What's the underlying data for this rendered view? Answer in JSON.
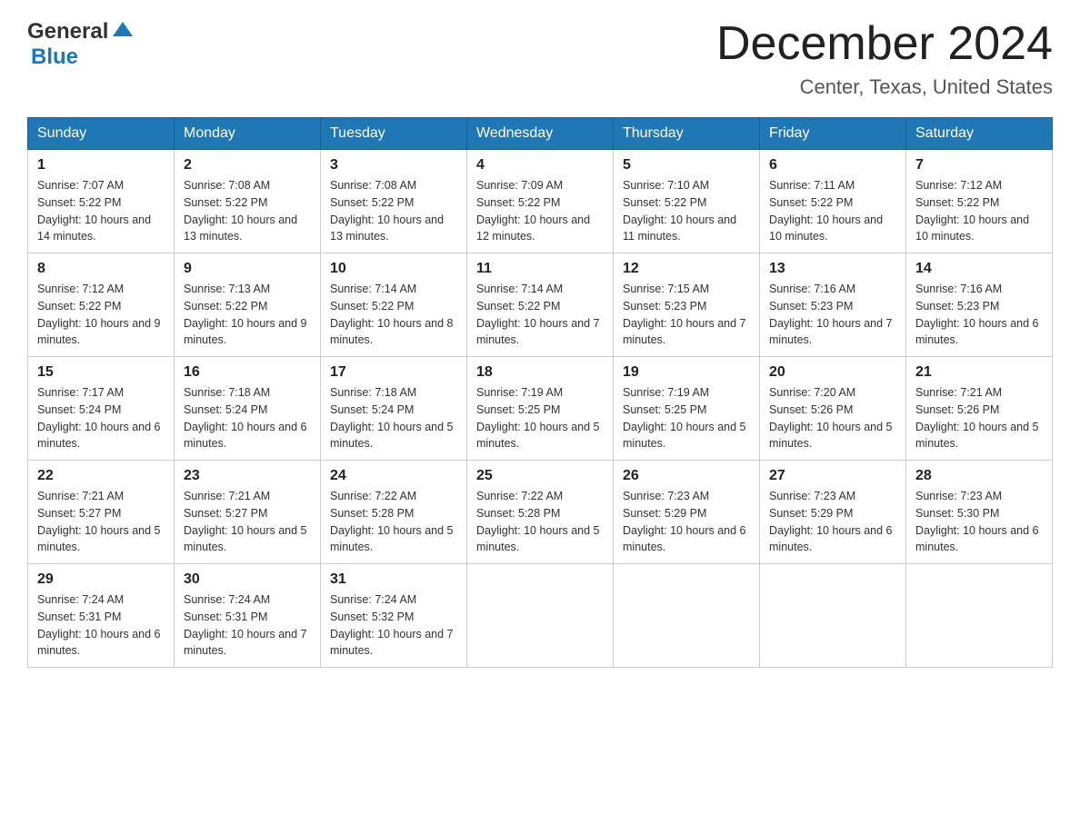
{
  "header": {
    "logo_general": "General",
    "logo_blue": "Blue",
    "month_year": "December 2024",
    "location": "Center, Texas, United States"
  },
  "days_of_week": [
    "Sunday",
    "Monday",
    "Tuesday",
    "Wednesday",
    "Thursday",
    "Friday",
    "Saturday"
  ],
  "weeks": [
    [
      {
        "day": "1",
        "sunrise": "Sunrise: 7:07 AM",
        "sunset": "Sunset: 5:22 PM",
        "daylight": "Daylight: 10 hours and 14 minutes."
      },
      {
        "day": "2",
        "sunrise": "Sunrise: 7:08 AM",
        "sunset": "Sunset: 5:22 PM",
        "daylight": "Daylight: 10 hours and 13 minutes."
      },
      {
        "day": "3",
        "sunrise": "Sunrise: 7:08 AM",
        "sunset": "Sunset: 5:22 PM",
        "daylight": "Daylight: 10 hours and 13 minutes."
      },
      {
        "day": "4",
        "sunrise": "Sunrise: 7:09 AM",
        "sunset": "Sunset: 5:22 PM",
        "daylight": "Daylight: 10 hours and 12 minutes."
      },
      {
        "day": "5",
        "sunrise": "Sunrise: 7:10 AM",
        "sunset": "Sunset: 5:22 PM",
        "daylight": "Daylight: 10 hours and 11 minutes."
      },
      {
        "day": "6",
        "sunrise": "Sunrise: 7:11 AM",
        "sunset": "Sunset: 5:22 PM",
        "daylight": "Daylight: 10 hours and 10 minutes."
      },
      {
        "day": "7",
        "sunrise": "Sunrise: 7:12 AM",
        "sunset": "Sunset: 5:22 PM",
        "daylight": "Daylight: 10 hours and 10 minutes."
      }
    ],
    [
      {
        "day": "8",
        "sunrise": "Sunrise: 7:12 AM",
        "sunset": "Sunset: 5:22 PM",
        "daylight": "Daylight: 10 hours and 9 minutes."
      },
      {
        "day": "9",
        "sunrise": "Sunrise: 7:13 AM",
        "sunset": "Sunset: 5:22 PM",
        "daylight": "Daylight: 10 hours and 9 minutes."
      },
      {
        "day": "10",
        "sunrise": "Sunrise: 7:14 AM",
        "sunset": "Sunset: 5:22 PM",
        "daylight": "Daylight: 10 hours and 8 minutes."
      },
      {
        "day": "11",
        "sunrise": "Sunrise: 7:14 AM",
        "sunset": "Sunset: 5:22 PM",
        "daylight": "Daylight: 10 hours and 7 minutes."
      },
      {
        "day": "12",
        "sunrise": "Sunrise: 7:15 AM",
        "sunset": "Sunset: 5:23 PM",
        "daylight": "Daylight: 10 hours and 7 minutes."
      },
      {
        "day": "13",
        "sunrise": "Sunrise: 7:16 AM",
        "sunset": "Sunset: 5:23 PM",
        "daylight": "Daylight: 10 hours and 7 minutes."
      },
      {
        "day": "14",
        "sunrise": "Sunrise: 7:16 AM",
        "sunset": "Sunset: 5:23 PM",
        "daylight": "Daylight: 10 hours and 6 minutes."
      }
    ],
    [
      {
        "day": "15",
        "sunrise": "Sunrise: 7:17 AM",
        "sunset": "Sunset: 5:24 PM",
        "daylight": "Daylight: 10 hours and 6 minutes."
      },
      {
        "day": "16",
        "sunrise": "Sunrise: 7:18 AM",
        "sunset": "Sunset: 5:24 PM",
        "daylight": "Daylight: 10 hours and 6 minutes."
      },
      {
        "day": "17",
        "sunrise": "Sunrise: 7:18 AM",
        "sunset": "Sunset: 5:24 PM",
        "daylight": "Daylight: 10 hours and 5 minutes."
      },
      {
        "day": "18",
        "sunrise": "Sunrise: 7:19 AM",
        "sunset": "Sunset: 5:25 PM",
        "daylight": "Daylight: 10 hours and 5 minutes."
      },
      {
        "day": "19",
        "sunrise": "Sunrise: 7:19 AM",
        "sunset": "Sunset: 5:25 PM",
        "daylight": "Daylight: 10 hours and 5 minutes."
      },
      {
        "day": "20",
        "sunrise": "Sunrise: 7:20 AM",
        "sunset": "Sunset: 5:26 PM",
        "daylight": "Daylight: 10 hours and 5 minutes."
      },
      {
        "day": "21",
        "sunrise": "Sunrise: 7:21 AM",
        "sunset": "Sunset: 5:26 PM",
        "daylight": "Daylight: 10 hours and 5 minutes."
      }
    ],
    [
      {
        "day": "22",
        "sunrise": "Sunrise: 7:21 AM",
        "sunset": "Sunset: 5:27 PM",
        "daylight": "Daylight: 10 hours and 5 minutes."
      },
      {
        "day": "23",
        "sunrise": "Sunrise: 7:21 AM",
        "sunset": "Sunset: 5:27 PM",
        "daylight": "Daylight: 10 hours and 5 minutes."
      },
      {
        "day": "24",
        "sunrise": "Sunrise: 7:22 AM",
        "sunset": "Sunset: 5:28 PM",
        "daylight": "Daylight: 10 hours and 5 minutes."
      },
      {
        "day": "25",
        "sunrise": "Sunrise: 7:22 AM",
        "sunset": "Sunset: 5:28 PM",
        "daylight": "Daylight: 10 hours and 5 minutes."
      },
      {
        "day": "26",
        "sunrise": "Sunrise: 7:23 AM",
        "sunset": "Sunset: 5:29 PM",
        "daylight": "Daylight: 10 hours and 6 minutes."
      },
      {
        "day": "27",
        "sunrise": "Sunrise: 7:23 AM",
        "sunset": "Sunset: 5:29 PM",
        "daylight": "Daylight: 10 hours and 6 minutes."
      },
      {
        "day": "28",
        "sunrise": "Sunrise: 7:23 AM",
        "sunset": "Sunset: 5:30 PM",
        "daylight": "Daylight: 10 hours and 6 minutes."
      }
    ],
    [
      {
        "day": "29",
        "sunrise": "Sunrise: 7:24 AM",
        "sunset": "Sunset: 5:31 PM",
        "daylight": "Daylight: 10 hours and 6 minutes."
      },
      {
        "day": "30",
        "sunrise": "Sunrise: 7:24 AM",
        "sunset": "Sunset: 5:31 PM",
        "daylight": "Daylight: 10 hours and 7 minutes."
      },
      {
        "day": "31",
        "sunrise": "Sunrise: 7:24 AM",
        "sunset": "Sunset: 5:32 PM",
        "daylight": "Daylight: 10 hours and 7 minutes."
      },
      null,
      null,
      null,
      null
    ]
  ]
}
